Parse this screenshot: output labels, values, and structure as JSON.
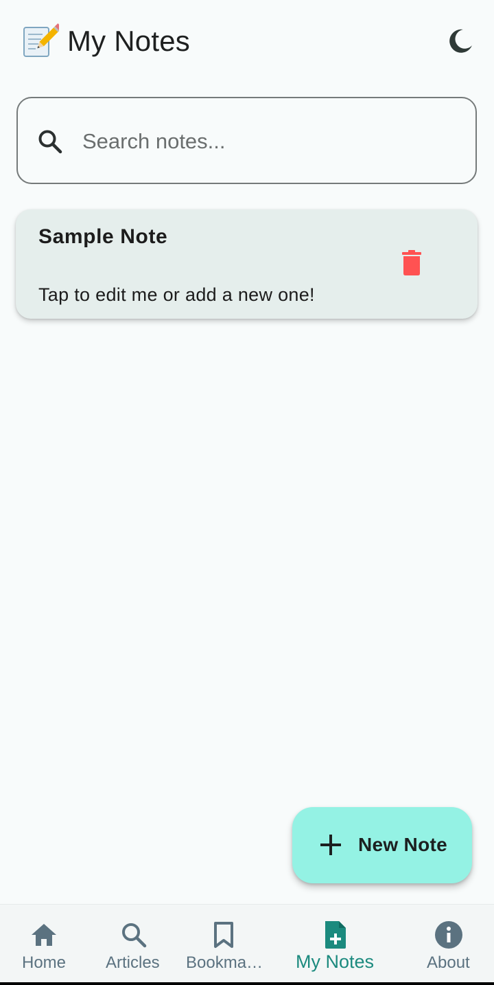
{
  "header": {
    "title": "My Notes",
    "emoji_icon": "memo-pencil-icon",
    "theme_toggle_icon": "moon-icon"
  },
  "search": {
    "placeholder": "Search notes...",
    "value": "",
    "icon": "search-icon"
  },
  "notes": [
    {
      "title": "Sample Note",
      "body": "Tap to edit me or add a new one!",
      "delete_icon": "trash-icon"
    }
  ],
  "fab": {
    "label": "New Note",
    "icon": "plus-icon"
  },
  "bottom_nav": {
    "items": [
      {
        "label": "Home",
        "icon": "home-icon",
        "active": false
      },
      {
        "label": "Articles",
        "icon": "search-icon",
        "active": false
      },
      {
        "label": "Bookma…",
        "icon": "bookmark-icon",
        "active": false
      },
      {
        "label": "My Notes",
        "icon": "note-add-icon",
        "active": true
      },
      {
        "label": "About",
        "icon": "info-icon",
        "active": false
      }
    ]
  },
  "colors": {
    "background": "#f8fbfb",
    "card": "#e5eeec",
    "fab": "#94f2e4",
    "accent": "#1b8a7e",
    "nav_inactive": "#5b7280",
    "delete": "#ff5252"
  }
}
